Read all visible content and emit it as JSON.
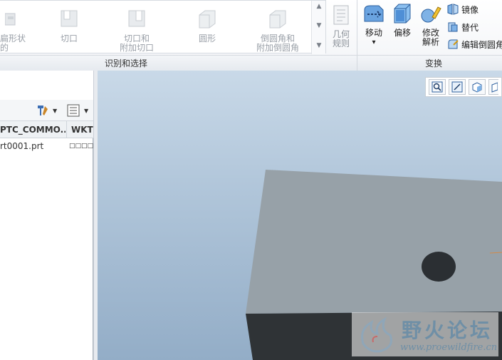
{
  "ribbon": {
    "gallery": [
      {
        "label_line1": "扁形状的",
        "label_line2": ""
      },
      {
        "label_line1": "切口",
        "label_line2": ""
      },
      {
        "label_line1": "切口和",
        "label_line2": "附加切口"
      },
      {
        "label_line1": "圆形",
        "label_line2": ""
      },
      {
        "label_line1": "倒圆角和",
        "label_line2": "附加倒圆角"
      }
    ],
    "geometry_rule": {
      "line1": "几何",
      "line2": "规则"
    },
    "group_identify": "识别和选择",
    "move": {
      "label": "移动",
      "arrow": "▾"
    },
    "offset": {
      "label": "偏移"
    },
    "modify": {
      "line1": "修改",
      "line2": "解析"
    },
    "mirror": {
      "label": "镜像"
    },
    "replace": {
      "label": "替代"
    },
    "edit_round": {
      "label": "编辑倒圆角"
    },
    "group_transform": "变换"
  },
  "tree": {
    "columns": [
      "PTC_COMMO...",
      "WKT"
    ],
    "rows": [
      {
        "name": "rt0001.prt",
        "wkt": "□□□□"
      }
    ]
  },
  "watermark": {
    "title": "野火论坛",
    "url": "www.proewildfire.cn"
  },
  "colors": {
    "accent": "#2a6fc9",
    "block_top": "#97a1a8",
    "block_front": "#2f3336"
  }
}
